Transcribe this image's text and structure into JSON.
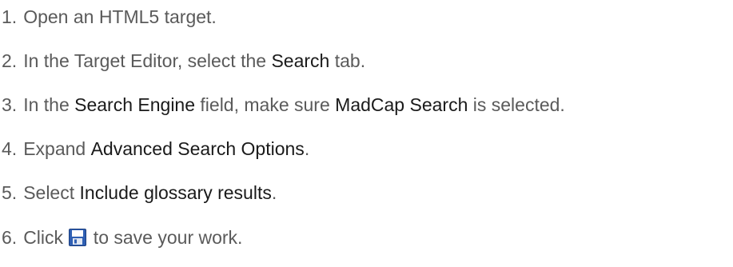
{
  "steps": [
    {
      "num": "1.",
      "parts": [
        {
          "t": "Open an HTML5 target.",
          "b": false
        }
      ]
    },
    {
      "num": "2.",
      "parts": [
        {
          "t": "In the Target Editor, select the ",
          "b": false
        },
        {
          "t": "Search",
          "b": true
        },
        {
          "t": " tab.",
          "b": false
        }
      ]
    },
    {
      "num": "3.",
      "parts": [
        {
          "t": "In the ",
          "b": false
        },
        {
          "t": "Search Engine",
          "b": true
        },
        {
          "t": " field, make sure ",
          "b": false
        },
        {
          "t": "MadCap Search",
          "b": true
        },
        {
          "t": " is selected.",
          "b": false
        }
      ]
    },
    {
      "num": "4.",
      "parts": [
        {
          "t": "Expand ",
          "b": false
        },
        {
          "t": "Advanced Search Options",
          "b": true
        },
        {
          "t": ".",
          "b": false
        }
      ]
    },
    {
      "num": "5.",
      "parts": [
        {
          "t": "Select ",
          "b": false
        },
        {
          "t": "Include glossary results",
          "b": true
        },
        {
          "t": ".",
          "b": false
        }
      ]
    },
    {
      "num": "6.",
      "parts": [
        {
          "t": "Click ",
          "b": false
        },
        {
          "icon": "save-icon"
        },
        {
          "t": " to save your work.",
          "b": false
        }
      ]
    }
  ]
}
